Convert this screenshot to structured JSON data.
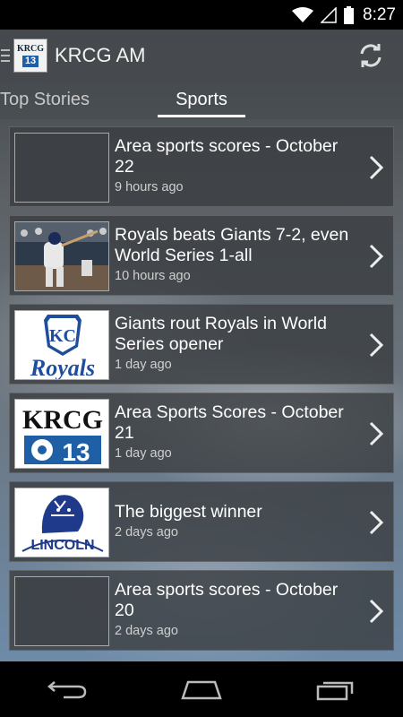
{
  "status_bar": {
    "time": "8:27"
  },
  "app_bar": {
    "title": "KRCG AM",
    "logo_line1": "KRCG",
    "logo_line2": "13"
  },
  "tabs": [
    {
      "label": "Top Stories"
    },
    {
      "label": "Sports"
    }
  ],
  "stories": [
    {
      "title": "Area sports scores - October 22",
      "time": "9 hours ago",
      "thumb": "blank"
    },
    {
      "title": "Royals beats Giants 7-2, even World Series 1-all",
      "time": "10 hours ago",
      "thumb": "baseball-photo"
    },
    {
      "title": "Giants rout Royals in World Series opener",
      "time": "1 day ago",
      "thumb": "royals-logo"
    },
    {
      "title": "Area Sports Scores - October 21",
      "time": "1 day ago",
      "thumb": "krcg-logo"
    },
    {
      "title": "The biggest winner",
      "time": "2 days ago",
      "thumb": "lincoln-logo"
    },
    {
      "title": "Area sports scores - October 20",
      "time": "2 days ago",
      "thumb": "blank"
    }
  ],
  "thumb_text": {
    "royals_kc": "KC",
    "royals_word": "Royals",
    "krcg": "KRCG",
    "krcg_13": "13",
    "lincoln": "LINCOLN"
  },
  "colors": {
    "royals_blue": "#1f4e9c",
    "cbs_blue": "#1f5fa6"
  }
}
